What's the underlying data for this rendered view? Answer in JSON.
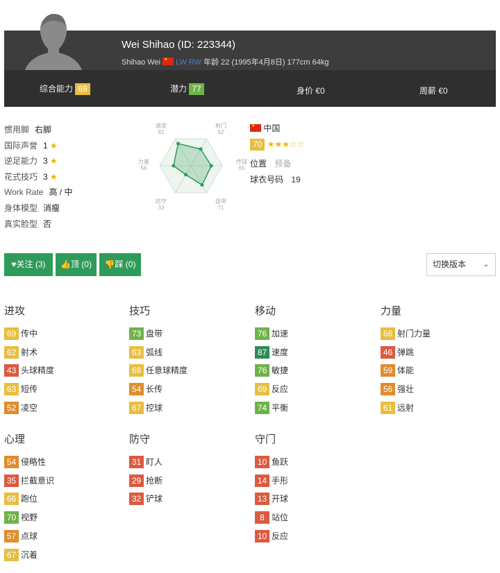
{
  "player": {
    "name": "Wei Shihao (ID: 223344)",
    "short_name": "Shihao Wei",
    "positions": "LW RW",
    "details": "年龄 22 (1995年4月8日) 177cm 64kg"
  },
  "summary": [
    {
      "label": "综合能力",
      "value": "69"
    },
    {
      "label": "潜力",
      "value": "77"
    },
    {
      "label": "身价 €0",
      "value": ""
    },
    {
      "label": "周薪 €0",
      "value": ""
    }
  ],
  "info": [
    {
      "label": "惯用脚",
      "value": "右脚"
    },
    {
      "label": "国际声誉",
      "value": "1",
      "stars": "★"
    },
    {
      "label": "逆足能力",
      "value": "3",
      "stars": "★"
    },
    {
      "label": "花式技巧",
      "value": "3",
      "stars": "★"
    },
    {
      "label": "Work Rate",
      "value": "高 / 中"
    },
    {
      "label": "身体模型",
      "value": "消瘦"
    },
    {
      "label": "真实脸型",
      "value": "否"
    }
  ],
  "radar": {
    "axes": [
      {
        "label": "速度",
        "value": "82"
      },
      {
        "label": "射门",
        "value": "62"
      },
      {
        "label": "传球",
        "value": "65"
      },
      {
        "label": "盘带",
        "value": "71"
      },
      {
        "label": "防守",
        "value": "33"
      },
      {
        "label": "力量",
        "value": "56"
      }
    ]
  },
  "right_info": {
    "nation": "中国",
    "rating": "70",
    "rating_stars": "★★★☆☆",
    "position_label": "位置",
    "position_value": "预备",
    "jersey_label": "球衣号码",
    "jersey_value": "19"
  },
  "buttons": {
    "follow": "关注 (3)",
    "up": "顶 (0)",
    "down": "踩 (0)",
    "switch_version": "切换版本"
  },
  "groups": [
    {
      "title": "进攻",
      "attrs": [
        {
          "v": "69",
          "n": "传中"
        },
        {
          "v": "62",
          "n": "射术"
        },
        {
          "v": "43",
          "n": "头球精度"
        },
        {
          "v": "63",
          "n": "短传"
        },
        {
          "v": "52",
          "n": "凌空"
        }
      ]
    },
    {
      "title": "技巧",
      "attrs": [
        {
          "v": "73",
          "n": "盘带"
        },
        {
          "v": "63",
          "n": "弧线"
        },
        {
          "v": "68",
          "n": "任意球精度"
        },
        {
          "v": "54",
          "n": "长传"
        },
        {
          "v": "67",
          "n": "控球"
        }
      ]
    },
    {
      "title": "移动",
      "attrs": [
        {
          "v": "76",
          "n": "加速"
        },
        {
          "v": "87",
          "n": "速度"
        },
        {
          "v": "76",
          "n": "敏捷"
        },
        {
          "v": "69",
          "n": "反应"
        },
        {
          "v": "74",
          "n": "平衡"
        }
      ]
    },
    {
      "title": "力量",
      "attrs": [
        {
          "v": "66",
          "n": "射门力量"
        },
        {
          "v": "46",
          "n": "弹跳"
        },
        {
          "v": "59",
          "n": "体能"
        },
        {
          "v": "56",
          "n": "强壮"
        },
        {
          "v": "61",
          "n": "远射"
        }
      ]
    },
    {
      "title": "心理",
      "attrs": [
        {
          "v": "54",
          "n": "侵略性"
        },
        {
          "v": "35",
          "n": "拦截意识"
        },
        {
          "v": "66",
          "n": "跑位"
        },
        {
          "v": "70",
          "n": "视野"
        },
        {
          "v": "57",
          "n": "点球"
        },
        {
          "v": "67",
          "n": "沉着"
        }
      ]
    },
    {
      "title": "防守",
      "attrs": [
        {
          "v": "31",
          "n": "盯人"
        },
        {
          "v": "29",
          "n": "抢断"
        },
        {
          "v": "32",
          "n": "铲球"
        }
      ]
    },
    {
      "title": "守门",
      "attrs": [
        {
          "v": "10",
          "n": "鱼跃"
        },
        {
          "v": "14",
          "n": "手形"
        },
        {
          "v": "13",
          "n": "开球"
        },
        {
          "v": "8",
          "n": "站位"
        },
        {
          "v": "10",
          "n": "反应"
        }
      ]
    }
  ]
}
